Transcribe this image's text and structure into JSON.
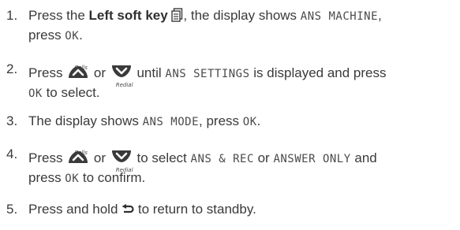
{
  "icons": {
    "calls_label": "Calls",
    "redial_label": "Redial"
  },
  "steps": [
    {
      "num": "1.",
      "t1": "Press the ",
      "bold": "Left soft key",
      "t2": ", the display shows ",
      "lcd1": "ANS MACHINE",
      "t3": ",",
      "t4": "press ",
      "lcd2": "OK",
      "t5": "."
    },
    {
      "num": "2.",
      "t1": "Press ",
      "t2": " or ",
      "t3": " until ",
      "lcd1": "ANS SETTINGS",
      "t4": " is displayed and press",
      "lcd2": "OK",
      "t5": " to select."
    },
    {
      "num": "3.",
      "t1": "The display shows ",
      "lcd1": "ANS MODE",
      "t2": ", press ",
      "lcd2": "OK",
      "t3": "."
    },
    {
      "num": "4.",
      "t1": "Press ",
      "t2": " or ",
      "t3": " to select ",
      "lcd1": "ANS & REC",
      "t4": " or ",
      "lcd2": "ANSWER ONLY",
      "t5": " and",
      "t6": "press ",
      "lcd3": "OK",
      "t7": " to confirm."
    },
    {
      "num": "5.",
      "t1": "Press and hold ",
      "t2": " to return to standby."
    }
  ]
}
